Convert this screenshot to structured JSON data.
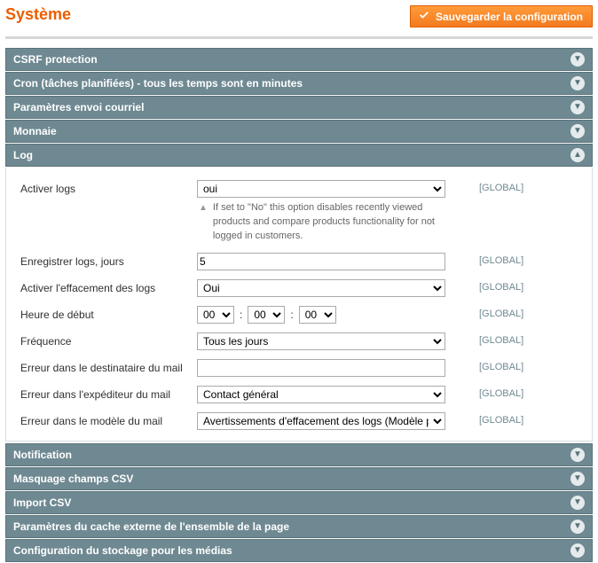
{
  "page_title": "Système",
  "save_button_label": "Sauvegarder la configuration",
  "scope_label": "[GLOBAL]",
  "sections": {
    "csrf": "CSRF protection",
    "cron": "Cron (tâches planifiées) - tous les temps sont en minutes",
    "mail": "Paramètres envoi courriel",
    "currency": "Monnaie",
    "log": "Log",
    "notification": "Notification",
    "csv_mask": "Masquage champs CSV",
    "csv_import": "Import CSV",
    "page_cache": "Paramètres du cache externe de l'ensemble de la page",
    "media_storage": "Configuration du stockage pour les médias"
  },
  "log": {
    "enable_label": "Activer logs",
    "enable_value": "oui",
    "enable_hint": "If set to \"No\" this option disables recently viewed products and compare products functionality for not logged in customers.",
    "save_days_label": "Enregistrer logs, jours",
    "save_days_value": "5",
    "cleaning_label": "Activer l'effacement des logs",
    "cleaning_value": "Oui",
    "start_time_label": "Heure de début",
    "start_hour": "00",
    "start_min": "00",
    "start_sec": "00",
    "frequency_label": "Fréquence",
    "frequency_value": "Tous les jours",
    "error_recipient_label": "Erreur dans le destinataire du mail",
    "error_recipient_value": "",
    "error_sender_label": "Erreur dans l'expéditeur du mail",
    "error_sender_value": "Contact général",
    "error_template_label": "Erreur dans le modèle du mail",
    "error_template_value": "Avertissements d'effacement des logs (Modèle p"
  }
}
